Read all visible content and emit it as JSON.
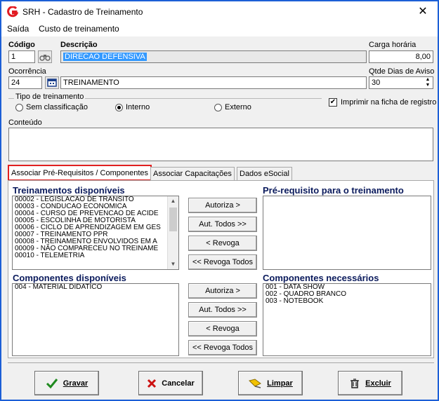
{
  "window": {
    "title": "SRH - Cadastro de Treinamento",
    "close": "✕"
  },
  "menu": [
    "Saída",
    "Custo de treinamento"
  ],
  "fields": {
    "codigo_label": "Código",
    "codigo_value": "1",
    "descricao_label": "Descrição",
    "descricao_value": "DIRECAO DEFENSIVA",
    "carga_label": "Carga horária",
    "carga_value": "8,00",
    "ocorrencia_label": "Ocorrência",
    "ocorrencia_value": "24",
    "ocorrencia_desc": "TREINAMENTO",
    "qtde_label": "Qtde Dias de Aviso",
    "qtde_value": "30"
  },
  "tipo": {
    "label": "Tipo de treinamento",
    "options": [
      "Sem classificação",
      "Interno",
      "Externo"
    ],
    "selected": "Interno"
  },
  "imprimir": {
    "label": "Imprimir na ficha de registro",
    "checked": true
  },
  "conteudo_label": "Conteúdo",
  "tabs": [
    "Associar Pré-Requisitos / Componentes",
    "Associar Capacitações",
    "Dados eSocial"
  ],
  "treinamentos": {
    "title": "Treinamentos disponíveis",
    "items": [
      "00002 - LEGISLACAO DE TRANSITO",
      "00003 - CONDUCAO ECONOMICA",
      "00004 - CURSO DE PREVENCAO DE ACIDE",
      "00005 - ESCOLINHA DE MOTORISTA",
      "00006 - CICLO DE APRENDIZAGEM EM GES",
      "00007 - TREINAMENTO PPR",
      "00008 - TREINAMENTO ENVOLVIDOS EM A",
      "00009 - NÃO COMPARECEU NO TREINAME",
      "00010 - TELEMETRIA"
    ]
  },
  "prereq": {
    "title": "Pré-requisito para o treinamento",
    "items": []
  },
  "componentes_disp": {
    "title": "Componentes disponíveis",
    "items": [
      "004 - MATERIAL DIDATICO"
    ]
  },
  "componentes_nec": {
    "title": "Componentes necessários",
    "items": [
      "001 - DATA SHOW",
      "002 - QUADRO BRANCO",
      "003 - NOTEBOOK"
    ]
  },
  "middle_buttons": [
    "Autoriza >",
    "Aut. Todos >>",
    "< Revoga",
    "<< Revoga Todos"
  ],
  "actions": [
    "Gravar",
    "Cancelar",
    "Limpar",
    "Excluir"
  ]
}
